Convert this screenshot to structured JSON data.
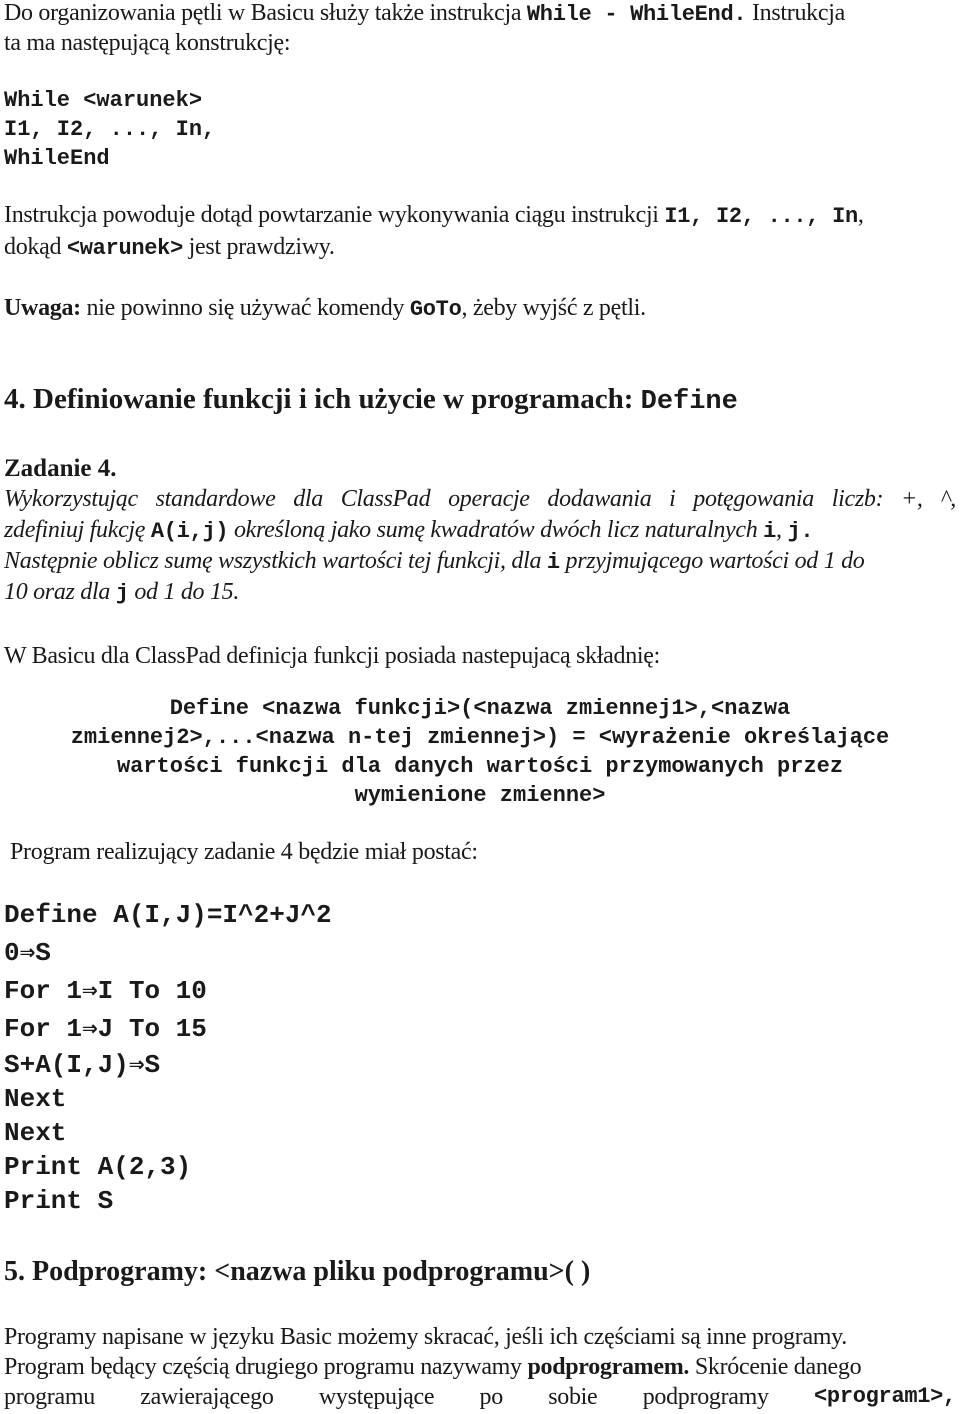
{
  "intro": {
    "line1_text": "Do organizowania pętli w Basicu służy także instrukcja ",
    "line1_code": "While - WhileEnd.",
    "line1_tail": " Instrukcja",
    "line2": "ta ma następującą konstrukcję:"
  },
  "while_syntax": [
    "While <warunek>",
    "I1, I2, ..., In,",
    "WhileEnd"
  ],
  "explain": {
    "line1_text": "Instrukcja powoduje dotąd powtarzanie wykonywania ciągu instrukcji ",
    "line1_code": "I1, I2, ..., In",
    "line1_tail": ",",
    "line2_text": "dokąd ",
    "line2_code": "<warunek>",
    "line2_tail": " jest prawdziwy."
  },
  "note": {
    "label": "Uwaga:",
    "text": " nie powinno się używać komendy ",
    "code": "GoTo",
    "tail": ", żeby wyjść z pętli."
  },
  "section4": {
    "number": "4.",
    "title": "Definiowanie funkcji i ich użycie w programach: ",
    "code": "Define"
  },
  "task": {
    "title": "Zadanie 4.",
    "line1_words": [
      "Wykorzystując",
      "standardowe",
      "dla",
      "ClassPad",
      "operacje",
      "dodawania",
      "i",
      "potęgowania",
      "liczb:",
      "+,",
      "^,"
    ],
    "line2": {
      "a": "zdefiniuj fukcję ",
      "code1": "A(i,j)",
      "b": " określoną jako sumę kwadratów dwóch licz naturalnych ",
      "code2": "i",
      "c": ", ",
      "code3": "j."
    },
    "line3": {
      "a": "Następnie oblicz sumę wszystkich wartości tej funkcji, dla ",
      "code": "i",
      "b": " przyjmującego wartości od 1 do"
    },
    "line4": {
      "a": "10 oraz dla ",
      "code": "j",
      "b": " od 1 do 15."
    }
  },
  "syntax_intro": "W Basicu dla ClassPad definicja funkcji posiada nastepujacą składnię:",
  "define_syntax": [
    "Define <nazwa funkcji>(<nazwa zmiennej1>,<nazwa",
    "zmiennej2>,...<nazwa n-tej zmiennej>) = <wyrażenie określające",
    "wartości funkcji dla danych wartości przymowanych przez",
    "wymienione zmienne>"
  ],
  "program_intro": "Program realizujący zadanie 4 będzie miał postać:",
  "program": [
    "Define A(I,J)=I^2+J^2",
    "0⇒S",
    "For 1⇒I To 10",
    "For 1⇒J To 15",
    "S+A(I,J)⇒S",
    "Next",
    "Next",
    "Print A(2,3)",
    "Print S"
  ],
  "section5": {
    "number": "5.",
    "title": "Podprogramy: <nazwa pliku podprogramu>( )"
  },
  "sub": {
    "line1": "Programy napisane w języku Basic możemy skracać, jeśli ich częściami są inne programy.",
    "line2_a": "Program będący częścią drugiego programu nazywamy ",
    "line2_bold": "podprogramem.",
    "line2_b": " Skrócenie danego",
    "line3_words": [
      "programu",
      "zawierającego",
      "występujące",
      "po",
      "sobie",
      "podprogramy"
    ],
    "line3_code": "<program1>,"
  }
}
